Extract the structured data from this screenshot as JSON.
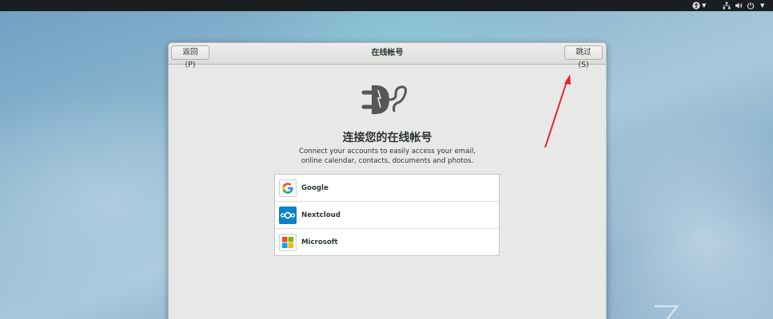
{
  "topbar": {
    "tray_icons": [
      "accessibility-icon",
      "network-icon",
      "volume-icon",
      "power-icon"
    ]
  },
  "dialog": {
    "title": "在线帐号",
    "back_label": "返回(P)",
    "skip_label": "跳过(S)",
    "heading": "连接您的在线帐号",
    "description_line1": "Connect your accounts to easily access your email,",
    "description_line2": "online calendar, contacts, documents and photos."
  },
  "providers": [
    {
      "name": "Google",
      "icon": "google-logo-icon"
    },
    {
      "name": "Nextcloud",
      "icon": "nextcloud-logo-icon"
    },
    {
      "name": "Microsoft",
      "icon": "microsoft-logo-icon"
    }
  ],
  "annotation": {
    "arrow_color": "#e1262c"
  },
  "colors": {
    "nextcloud_blue": "#0b82c9",
    "topbar_bg": "#1b1e20"
  }
}
